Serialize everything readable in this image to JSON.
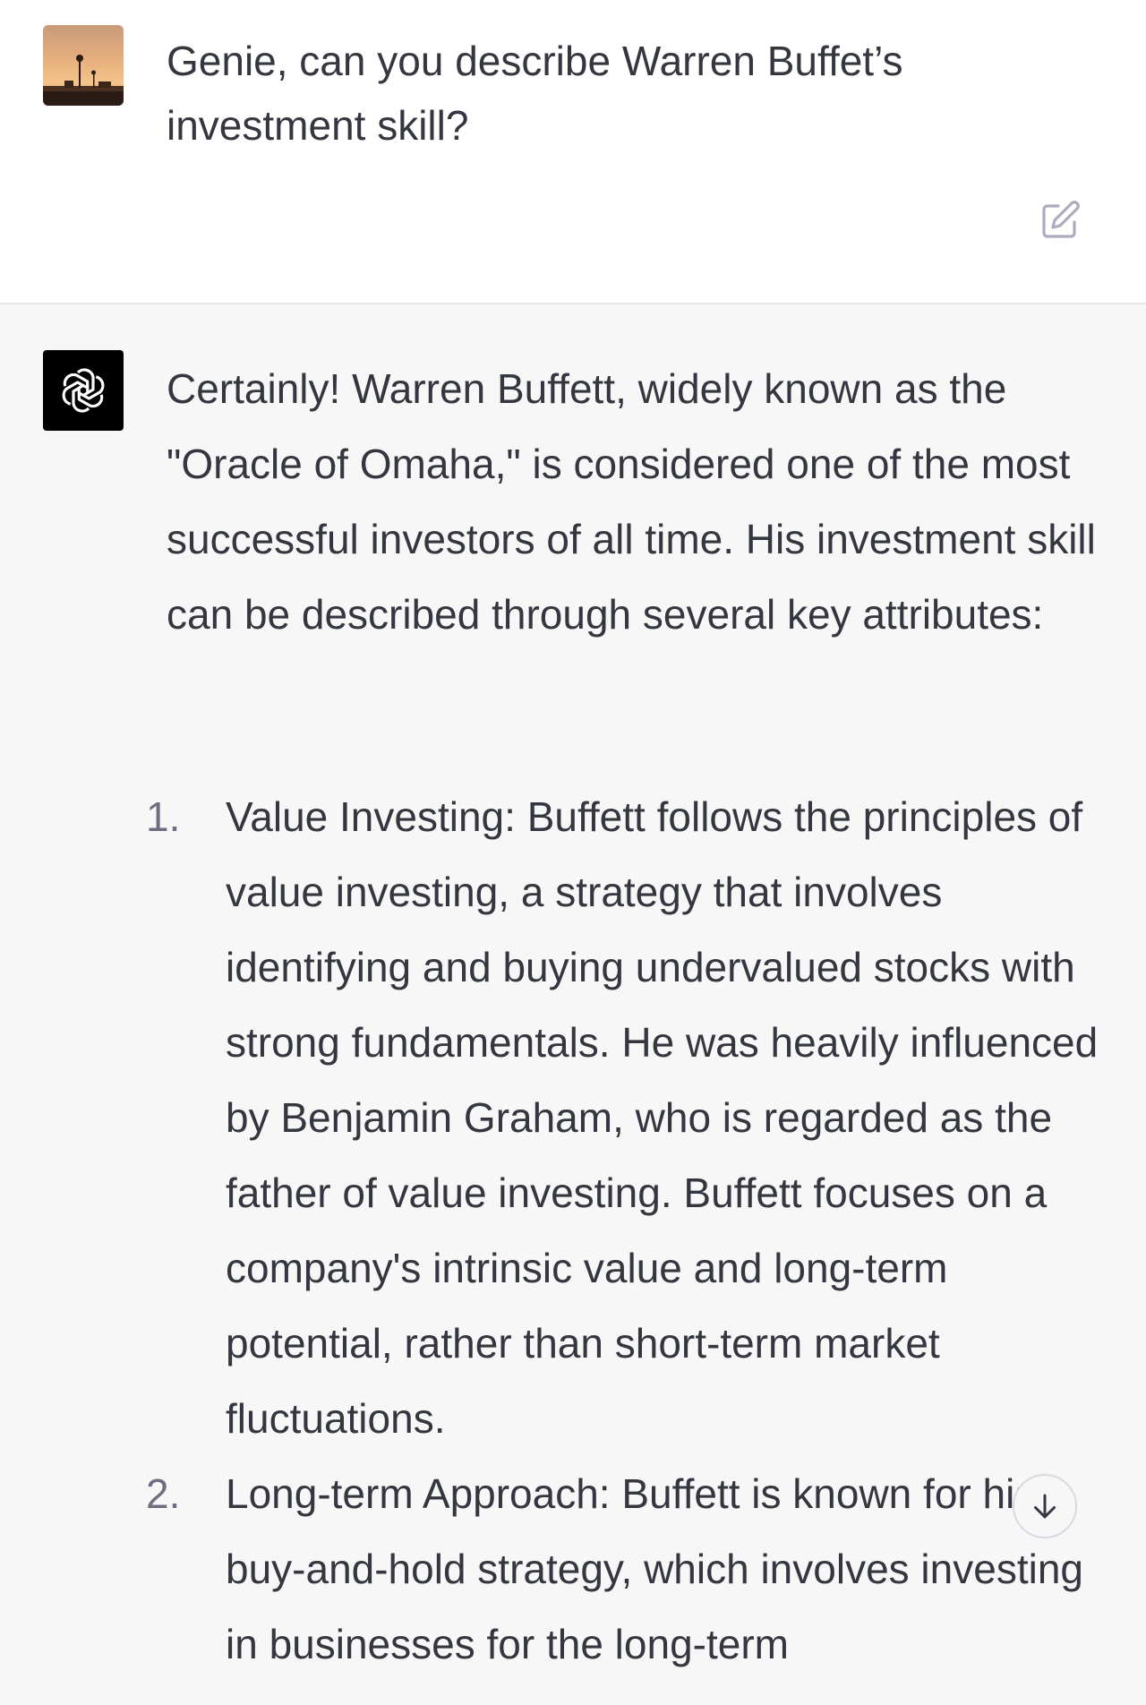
{
  "user": {
    "message": "Genie, can you describe Warren Buffet’s investment skill?"
  },
  "assistant": {
    "intro": "Certainly! Warren Buffett, widely known as the \"Oracle of Omaha,\" is considered one of the most successful investors of all time. His investment skill can be described through several key attributes:",
    "list": [
      {
        "number": "1.",
        "text": "Value Investing: Buffett follows the principles of value investing, a strategy that involves identifying and buying undervalued stocks with strong fundamentals. He was heavily influenced by Benjamin Graham, who is regarded as the father of value investing. Buffett focuses on a company's intrinsic value and long-term potential, rather than short-term market fluctuations."
      },
      {
        "number": "2.",
        "text": "Long-term Approach: Buffett is known for his buy-and-hold strategy, which involves investing in businesses for the long-term"
      }
    ]
  },
  "icons": {
    "user_avatar": "sunset-photo-avatar",
    "assistant_avatar": "openai-logo-icon",
    "edit": "edit-icon",
    "scroll_down": "arrow-down-icon"
  },
  "colors": {
    "user_bg": "#ffffff",
    "assistant_bg": "#f7f7f8",
    "text": "#353740",
    "number": "#6e6e80",
    "icon_gray": "#acacbe"
  }
}
